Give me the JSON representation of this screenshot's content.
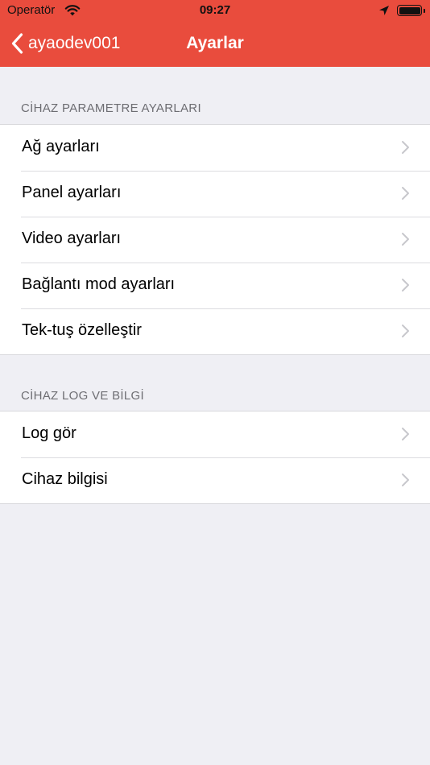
{
  "status": {
    "carrier": "Operatör",
    "time": "09:27"
  },
  "nav": {
    "back_label": "ayaodev001",
    "title": "Ayarlar"
  },
  "sections": [
    {
      "header": "CİHAZ PARAMETRE AYARLARI",
      "items": [
        {
          "label": "Ağ ayarları"
        },
        {
          "label": "Panel ayarları"
        },
        {
          "label": "Video ayarları"
        },
        {
          "label": "Bağlantı mod ayarları"
        },
        {
          "label": "Tek-tuş özelleştir"
        }
      ]
    },
    {
      "header": "CİHAZ LOG VE BİLGİ",
      "items": [
        {
          "label": "Log gör"
        },
        {
          "label": "Cihaz bilgisi"
        }
      ]
    }
  ],
  "colors": {
    "accent": "#e94c3d",
    "background": "#efeff4"
  },
  "icons": [
    "wifi-icon",
    "location-arrow-icon",
    "battery-icon",
    "back-chevron-icon",
    "chevron-right-icon"
  ]
}
